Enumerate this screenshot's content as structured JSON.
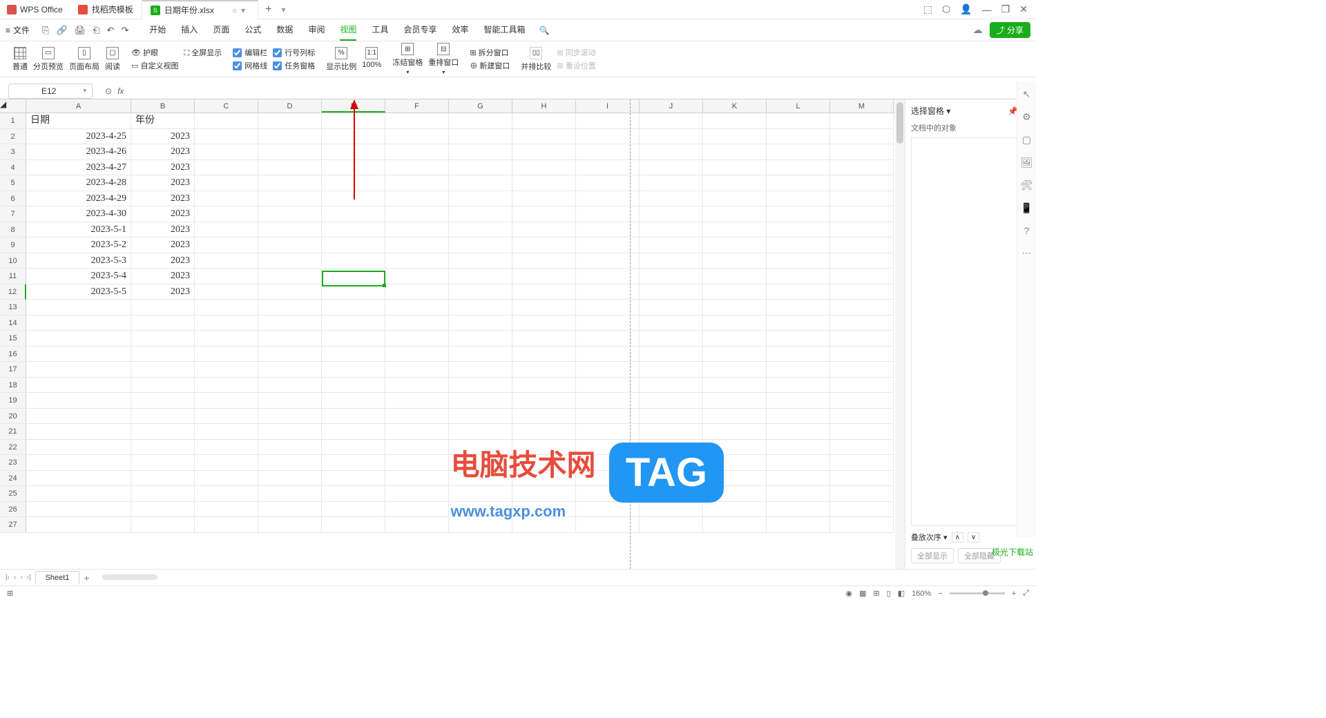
{
  "app": {
    "name": "WPS Office"
  },
  "tabs": [
    {
      "label": "找稻壳模板",
      "icon": "red"
    },
    {
      "label": "日期年份.xlsx",
      "icon": "green",
      "active": true
    }
  ],
  "window_controls": {
    "more": "⬚",
    "hex": "⬡",
    "user": "👤",
    "min": "—",
    "max": "❐",
    "close": "✕"
  },
  "menu": {
    "file": "文件",
    "items": [
      "开始",
      "插入",
      "页面",
      "公式",
      "数据",
      "审阅",
      "视图",
      "工具",
      "会员专享",
      "效率",
      "智能工具箱"
    ],
    "active": "视图"
  },
  "quick": [
    "⎘",
    "🔗",
    "🖨",
    "⎗",
    "↶",
    "↷"
  ],
  "share": "分享",
  "ribbon": {
    "view_modes": [
      {
        "label": "普通",
        "icon": "普"
      },
      {
        "label": "分页预览",
        "icon": "分"
      },
      {
        "label": "页面布局",
        "icon": "页"
      },
      {
        "label": "阅读",
        "icon": "阅"
      }
    ],
    "protect": "护眼",
    "fullscreen": "全屏显示",
    "custom_view": "自定义视图",
    "checks": {
      "edit_bar": "编辑栏",
      "row_col": "行号列标",
      "gridlines": "网格线",
      "task_pane": "任务窗格"
    },
    "zoom_ratio": "显示比例",
    "zoom_100": "100%",
    "freeze": "冻结窗格",
    "arrange": "重排窗口",
    "split": "拆分窗口",
    "new_window": "新建窗口",
    "side_by_side": "并排比较",
    "sync_scroll": "同步滚动",
    "reset_pos": "重设位置"
  },
  "formula": {
    "cell_ref": "E12",
    "fx": "fx",
    "value": ""
  },
  "columns": [
    "A",
    "B",
    "C",
    "D",
    "E",
    "F",
    "G",
    "H",
    "I",
    "J",
    "K",
    "L",
    "M"
  ],
  "headers": {
    "a": "日期",
    "b": "年份"
  },
  "rows": [
    {
      "a": "2023-4-25",
      "b": "2023"
    },
    {
      "a": "2023-4-26",
      "b": "2023"
    },
    {
      "a": "2023-4-27",
      "b": "2023"
    },
    {
      "a": "2023-4-28",
      "b": "2023"
    },
    {
      "a": "2023-4-29",
      "b": "2023"
    },
    {
      "a": "2023-4-30",
      "b": "2023"
    },
    {
      "a": "2023-5-1",
      "b": "2023"
    },
    {
      "a": "2023-5-2",
      "b": "2023"
    },
    {
      "a": "2023-5-3",
      "b": "2023"
    },
    {
      "a": "2023-5-4",
      "b": "2023"
    },
    {
      "a": "2023-5-5",
      "b": "2023"
    }
  ],
  "row_count": 27,
  "side_panel": {
    "title": "选择窗格",
    "subtitle": "文档中的对象",
    "stack": "叠放次序",
    "show_all": "全部显示",
    "hide_all": "全部隐藏"
  },
  "sheet": {
    "name": "Sheet1"
  },
  "status": {
    "icon": "⊞",
    "zoom": "160%"
  },
  "watermark": {
    "text": "电脑技术网",
    "url": "www.tagxp.com",
    "tag": "TAG",
    "logo": "极光下载站"
  }
}
